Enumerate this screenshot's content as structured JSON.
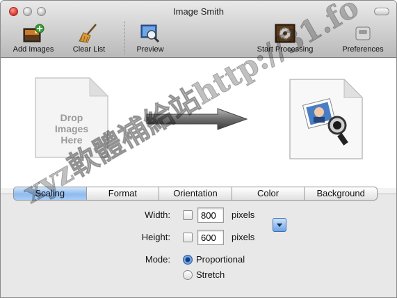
{
  "window": {
    "title": "Image Smith"
  },
  "toolbar": {
    "add_images": "Add Images",
    "clear_list": "Clear List",
    "preview": "Preview",
    "start_processing": "Start Processing",
    "preferences": "Preferences"
  },
  "drop_zone": {
    "text_line1": "Drop",
    "text_line2": "Images",
    "text_line3": "Here"
  },
  "tabs": [
    "Scaling",
    "Format",
    "Orientation",
    "Color",
    "Background"
  ],
  "active_tab": "Scaling",
  "scaling": {
    "width_label": "Width:",
    "width_value": "800",
    "height_label": "Height:",
    "height_value": "600",
    "unit": "pixels",
    "mode_label": "Mode:",
    "mode_options": [
      "Proportional",
      "Stretch"
    ],
    "mode_selected": "Proportional"
  },
  "watermark": {
    "text": "xyz軟體補給站http://31.fo"
  },
  "colors": {
    "active_tab": "#8fbbef",
    "close": "#d8312a"
  }
}
